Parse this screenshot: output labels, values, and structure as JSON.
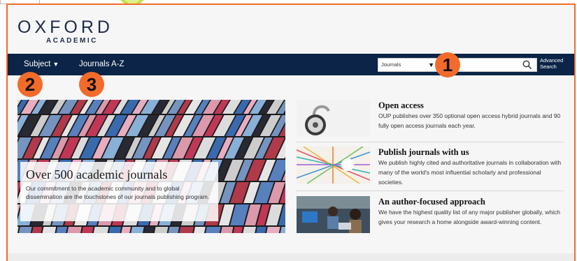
{
  "logo": {
    "top": "OXFORD",
    "bottom": "ACADEMIC"
  },
  "nav": {
    "subject_label": "Subject",
    "subject_caret": "▼",
    "journals_label": "Journals A-Z",
    "search_select_value": "Journals",
    "search_select_caret": "▼",
    "search_placeholder": "",
    "advanced_line1": "Advanced",
    "advanced_line2": "Search"
  },
  "badges": [
    "1",
    "2",
    "3"
  ],
  "hero": {
    "title": "Over 500 academic journals",
    "text": "Our commitment to the academic community and to global dissemination are the touchstones of our journals publishing program."
  },
  "features": [
    {
      "title": "Open access",
      "text": "OUP publishes over 350 optional open access hybrid journals and 90 fully open access journals each year.",
      "icon": "padlock-icon"
    },
    {
      "title": "Publish journals with us",
      "text": "We publish highly cited and authoritative journals in collaboration with many of the world's most influential scholarly and professional societies.",
      "icon": "network-threads-icon"
    },
    {
      "title": "An author-focused approach",
      "text": "We have the highest quality list of any major publisher globally, which gives your research a home alongside award-winning content.",
      "icon": "authors-photo-icon"
    }
  ],
  "colors": {
    "nav_bg": "#0b2447",
    "accent": "#f26b2a",
    "logo": "#1d2b4c"
  }
}
